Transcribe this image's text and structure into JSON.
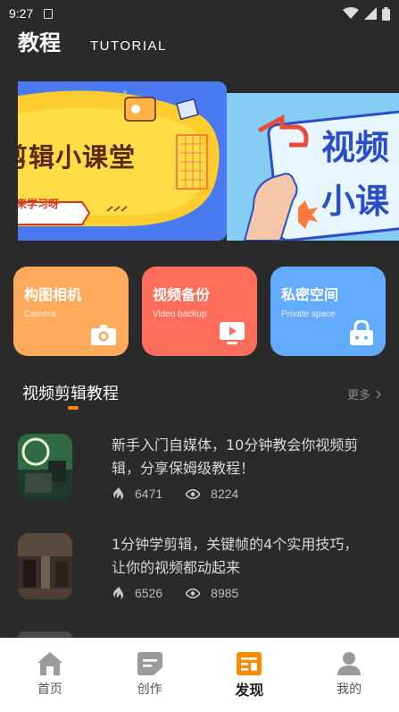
{
  "status_bar": {
    "time": "9:27"
  },
  "header": {
    "title": "教程",
    "subtitle": "TUTORIAL"
  },
  "banners": [
    {
      "headline": "剪辑小课堂",
      "tag": "来学习呀"
    },
    {
      "headline_line1": "视频",
      "headline_line2": "小课"
    }
  ],
  "shortcuts": [
    {
      "title": "构图相机",
      "subtitle": "Camera",
      "icon": "camera-icon",
      "color": "#ffab5b"
    },
    {
      "title": "视频备份",
      "subtitle": "Video backup",
      "icon": "video-play-icon",
      "color": "#ff6e5a"
    },
    {
      "title": "私密空间",
      "subtitle": "Private space",
      "icon": "lock-icon",
      "color": "#63abff"
    }
  ],
  "section": {
    "title": "视频剪辑教程",
    "more": "更多"
  },
  "articles": [
    {
      "title": "新手入门自媒体，10分钟教会你视频剪辑，分享保姆级教程！",
      "likes": "6471",
      "views": "8224"
    },
    {
      "title": "1分钟学剪辑，关键帧的4个实用技巧，让你的视频都动起来",
      "likes": "6526",
      "views": "8985"
    }
  ],
  "tabs": [
    {
      "label": "首页",
      "icon": "home-icon",
      "active": false
    },
    {
      "label": "创作",
      "icon": "create-icon",
      "active": false
    },
    {
      "label": "发现",
      "icon": "discover-icon",
      "active": true
    },
    {
      "label": "我的",
      "icon": "profile-icon",
      "active": false
    }
  ],
  "colors": {
    "accent": "#ff8a00",
    "background": "#2a2a2a",
    "tab_active": "#ff8a00",
    "tab_inactive": "#9a9a9a"
  }
}
